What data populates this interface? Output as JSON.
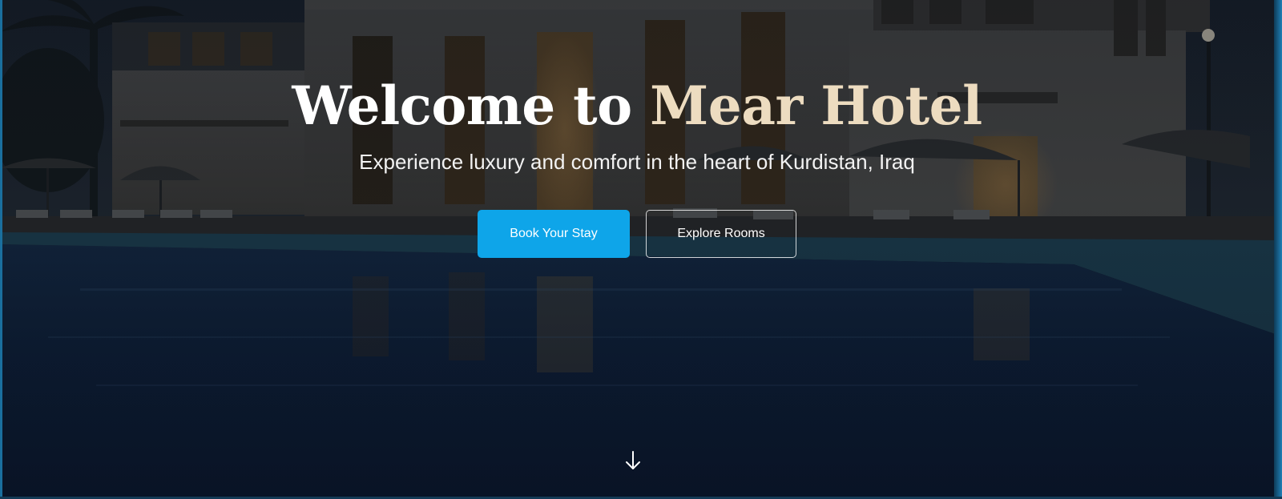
{
  "hero": {
    "title_main": "Welcome to ",
    "title_accent": "Mear Hotel",
    "subtitle": "Experience luxury and comfort in the heart of Kurdistan, Iraq",
    "primary_button": "Book Your Stay",
    "secondary_button": "Explore Rooms",
    "scroll_icon": "arrow-down-icon"
  },
  "colors": {
    "accent_gold": "#eddcc0",
    "primary_button": "#0ea5e9",
    "background": "#0b1220"
  }
}
